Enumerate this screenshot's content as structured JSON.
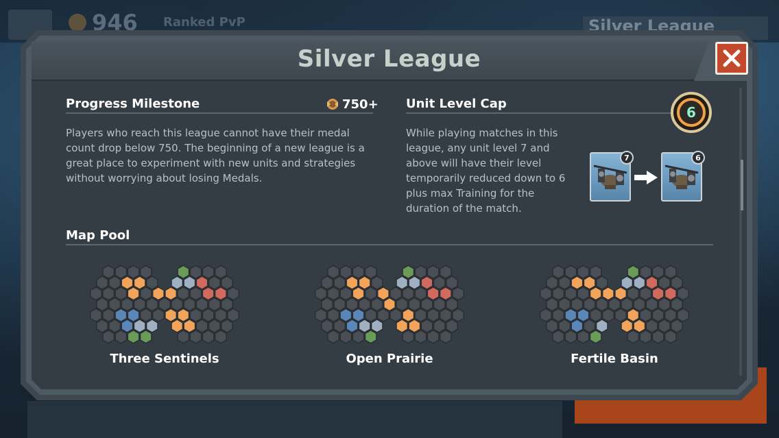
{
  "background": {
    "medals": "946",
    "mode": "Ranked PvP",
    "league_tab": "Silver League"
  },
  "modal": {
    "title": "Silver League",
    "close_icon": "close-icon"
  },
  "progress": {
    "heading": "Progress Milestone",
    "medal_value": "750+",
    "description": "Players who reach this league cannot have their medal count drop below 750. The beginning of a new league is a great place to experiment with new units and strategies without worrying about losing Medals."
  },
  "unit_cap": {
    "heading": "Unit Level Cap",
    "cap": "6",
    "description": "While playing matches in this league, any unit level 7 and above will have their level temporarily reduced down to 6 plus max Training for the duration of the match.",
    "before_level": "7",
    "after_level": "6"
  },
  "map_pool": {
    "heading": "Map Pool",
    "maps": [
      {
        "name": "Three Sentinels"
      },
      {
        "name": "Open Prairie"
      },
      {
        "name": "Fertile Basin"
      }
    ]
  },
  "colors": {
    "hex_default": "#4a4f55",
    "hex_orange": "#f2a55a",
    "hex_blue": "#5b86b8",
    "hex_green": "#6a9c58",
    "hex_red": "#d16a5e",
    "hex_silver": "#9fb0c2",
    "close_button": "#c4492c"
  }
}
